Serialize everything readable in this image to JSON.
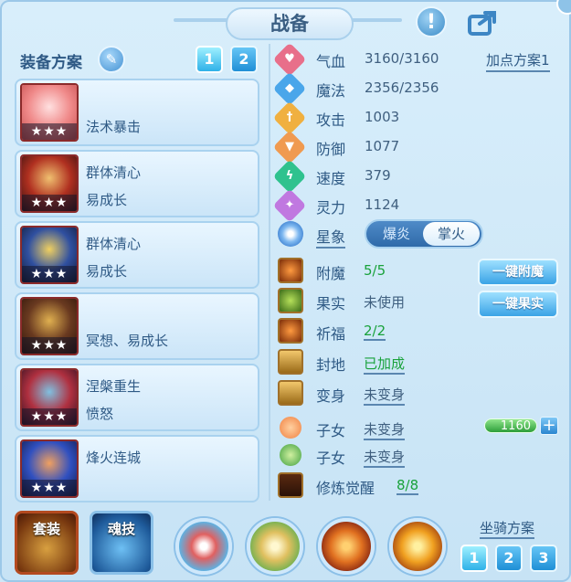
{
  "window": {
    "title": "战备"
  },
  "equipment": {
    "label": "装备方案",
    "scheme_buttons": [
      "1",
      "2"
    ],
    "items": [
      {
        "line1": "",
        "line2": "法术暴击",
        "stars": "★★★"
      },
      {
        "line1": "群体清心",
        "line2": "易成长",
        "stars": "★★★"
      },
      {
        "line1": "群体清心",
        "line2": "易成长",
        "stars": "★★★"
      },
      {
        "line1": "",
        "line2": "冥想、易成长",
        "stars": "★★★"
      },
      {
        "line1": "涅槃重生",
        "line2": "愤怒",
        "stars": "★★★"
      },
      {
        "line1": "烽火连城",
        "line2": "",
        "stars": "★★★"
      }
    ]
  },
  "attributes": {
    "add_scheme": "加点方案1",
    "rows": [
      {
        "name": "气血",
        "value": "3160/3160",
        "icon": "heart-icon",
        "color": "#e86f8a"
      },
      {
        "name": "魔法",
        "value": "2356/2356",
        "icon": "mana-icon",
        "color": "#4aa6ea"
      },
      {
        "name": "攻击",
        "value": "1003",
        "icon": "sword-icon",
        "color": "#f0b040"
      },
      {
        "name": "防御",
        "value": "1077",
        "icon": "shield-icon",
        "color": "#f09a50"
      },
      {
        "name": "速度",
        "value": "379",
        "icon": "lightning-icon",
        "color": "#2fc28e"
      },
      {
        "name": "灵力",
        "value": "1124",
        "icon": "spirit-icon",
        "color": "#c078e0"
      }
    ]
  },
  "star_sign": {
    "label": "星象",
    "options": [
      "爆炎",
      "掌火"
    ]
  },
  "bonuses": [
    {
      "name": "附魔",
      "value": "5/5",
      "green": true
    },
    {
      "name": "果实",
      "value": "未使用",
      "green": false
    },
    {
      "name": "祈福",
      "value": "2/2",
      "green": true
    },
    {
      "name": "封地",
      "value": "已加成",
      "green": true
    },
    {
      "name": "变身",
      "value": "未变身",
      "green": false
    }
  ],
  "buttons": {
    "enchant": "一键附魔",
    "fruit": "一键果实"
  },
  "children": [
    {
      "name": "子女",
      "value": "未变身"
    },
    {
      "name": "子女",
      "value": "未变身"
    }
  ],
  "cultivation": {
    "name": "修炼觉醒",
    "value": "8/8"
  },
  "bar_value": "1160",
  "bottom": {
    "suit": "套装",
    "soul": "魂技",
    "mount_label": "坐骑方案",
    "mount_buttons": [
      "1",
      "2",
      "3"
    ]
  }
}
